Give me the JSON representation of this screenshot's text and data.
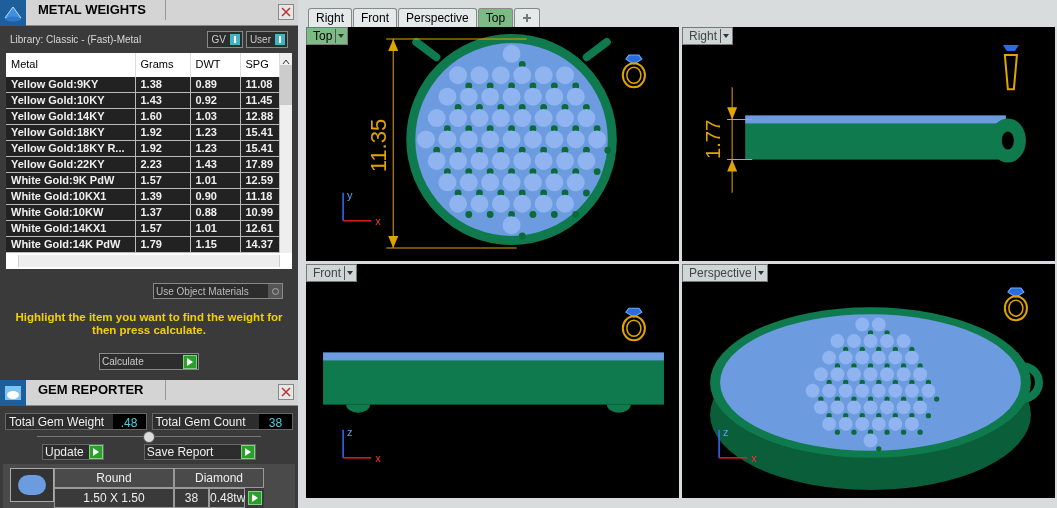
{
  "metal_weights": {
    "title": "METAL WEIGHTS",
    "library": "Library: Classic - (Fast)-Metal",
    "toggles": [
      {
        "label": "GV",
        "on": true
      },
      {
        "label": "User",
        "on": true
      }
    ],
    "table": {
      "columns": [
        "Metal",
        "Grams",
        "DWT",
        "SPG"
      ],
      "rows": [
        [
          "Yellow Gold:9KY",
          "1.38",
          "0.89",
          "11.08"
        ],
        [
          "Yellow Gold:10KY",
          "1.43",
          "0.92",
          "11.45"
        ],
        [
          "Yellow Gold:14KY",
          "1.60",
          "1.03",
          "12.88"
        ],
        [
          "Yellow Gold:18KY",
          "1.92",
          "1.23",
          "15.41"
        ],
        [
          "Yellow Gold:18KY R...",
          "1.92",
          "1.23",
          "15.41"
        ],
        [
          "Yellow Gold:22KY",
          "2.23",
          "1.43",
          "17.89"
        ],
        [
          "White Gold:9K PdW",
          "1.57",
          "1.01",
          "12.59"
        ],
        [
          "White Gold:10KX1",
          "1.39",
          "0.90",
          "11.18"
        ],
        [
          "White Gold:10KW",
          "1.37",
          "0.88",
          "10.99"
        ],
        [
          "White Gold:14KX1",
          "1.57",
          "1.01",
          "12.61"
        ],
        [
          "White Gold:14K PdW",
          "1.79",
          "1.15",
          "14.37"
        ]
      ]
    },
    "use_object_materials": {
      "label": "Use Object Materials",
      "checked": false
    },
    "hint": "Highlight the item you want to find the weight for then press calculate.",
    "calculate": "Calculate"
  },
  "gem_reporter": {
    "title": "GEM REPORTER",
    "totals": [
      {
        "label": "Total Gem Weight",
        "value": ".48"
      },
      {
        "label": "Total Gem Count",
        "value": "38"
      }
    ],
    "slider": {
      "level": 0.5
    },
    "buttons": [
      "Update",
      "Save Report"
    ],
    "gems": [
      {
        "shape": "Round",
        "type": "Diamond",
        "size": "1.50 X 1.50",
        "count": "38",
        "weight": "0.48tw"
      }
    ]
  },
  "tabs": [
    {
      "label": "Right",
      "selected": false
    },
    {
      "label": "Front",
      "selected": false
    },
    {
      "label": "Perspective",
      "selected": false
    },
    {
      "label": "Top",
      "selected": true
    }
  ],
  "viewports": [
    {
      "label": "Top",
      "kind": "top",
      "active": true,
      "dimension": "11.35",
      "axes": [
        "y",
        "x"
      ]
    },
    {
      "label": "Right",
      "kind": "right",
      "active": false,
      "dimension": "1.77"
    },
    {
      "label": "Front",
      "kind": "front",
      "active": false,
      "axes": [
        "z",
        "x"
      ]
    },
    {
      "label": "Perspective",
      "kind": "perspective",
      "active": false,
      "axes": [
        "z",
        "x"
      ]
    }
  ]
}
